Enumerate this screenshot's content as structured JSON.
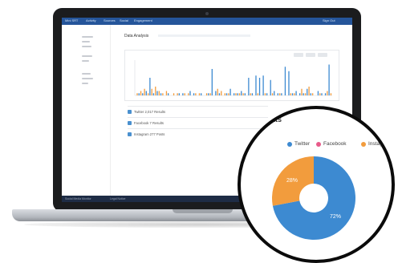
{
  "app": {
    "top_nav": [
      "Mini SRT",
      "Activity",
      "Sources",
      "Social",
      "Engagement"
    ],
    "top_nav_right": "Sign Out",
    "footer_left": "Social Media Monitor",
    "footer_mid": "Legal Notice",
    "panel_title": "Data Analysis"
  },
  "sources": [
    {
      "label": "Twitter 2,017 Results"
    },
    {
      "label": "Facebook 7 Results"
    },
    {
      "label": "Instagram 277 Posts"
    }
  ],
  "chart_data": {
    "type": "bar",
    "series": [
      {
        "name": "Twitter",
        "color": "#3d8ad1",
        "values": [
          0,
          1,
          1,
          2,
          8,
          1,
          2,
          1,
          0,
          1,
          0,
          0,
          1,
          1,
          0,
          2,
          1,
          0,
          1,
          0,
          1,
          12,
          2,
          1,
          0,
          1,
          3,
          1,
          1,
          2,
          1,
          8,
          1,
          9,
          8,
          9,
          1,
          7,
          2,
          1,
          1,
          13,
          11,
          1,
          2,
          1,
          1,
          3,
          1,
          0,
          2,
          1,
          1,
          14
        ]
      },
      {
        "name": "Facebook",
        "color": "#e85b8a",
        "values": [
          0,
          0,
          0,
          0,
          0,
          0,
          0,
          0,
          0,
          0,
          0,
          0,
          0,
          0,
          0,
          0,
          0,
          0,
          0,
          0,
          0,
          0,
          0,
          0,
          0,
          0,
          0,
          0,
          0,
          0,
          0,
          0,
          0,
          0,
          0,
          0,
          0,
          0,
          0,
          0,
          0,
          0,
          0,
          0,
          0,
          0,
          0,
          0,
          0,
          0,
          0,
          0,
          0,
          0
        ]
      },
      {
        "name": "Instagram",
        "color": "#f29c3d",
        "values": [
          1,
          2,
          3,
          1,
          3,
          4,
          2,
          1,
          2,
          0,
          1,
          1,
          0,
          1,
          1,
          0,
          1,
          1,
          0,
          1,
          1,
          0,
          3,
          2,
          1,
          1,
          0,
          1,
          1,
          1,
          0,
          1,
          0,
          1,
          0,
          1,
          0,
          1,
          0,
          1,
          0,
          0,
          1,
          1,
          0,
          3,
          1,
          4,
          1,
          0,
          1,
          0,
          2,
          1
        ]
      }
    ],
    "ylim": [
      0,
      16
    ]
  },
  "donut": {
    "legend": [
      {
        "name": "Twitter",
        "color": "#3d8ad1"
      },
      {
        "name": "Facebook",
        "color": "#e85b8a"
      },
      {
        "name": "Instagram",
        "color": "#f29c3d"
      }
    ],
    "slices": [
      {
        "name": "Twitter",
        "value": 72,
        "label": "72%",
        "color": "#3d8ad1"
      },
      {
        "name": "Instagram",
        "value": 28,
        "label": "28%",
        "color": "#f29c3d"
      }
    ]
  }
}
